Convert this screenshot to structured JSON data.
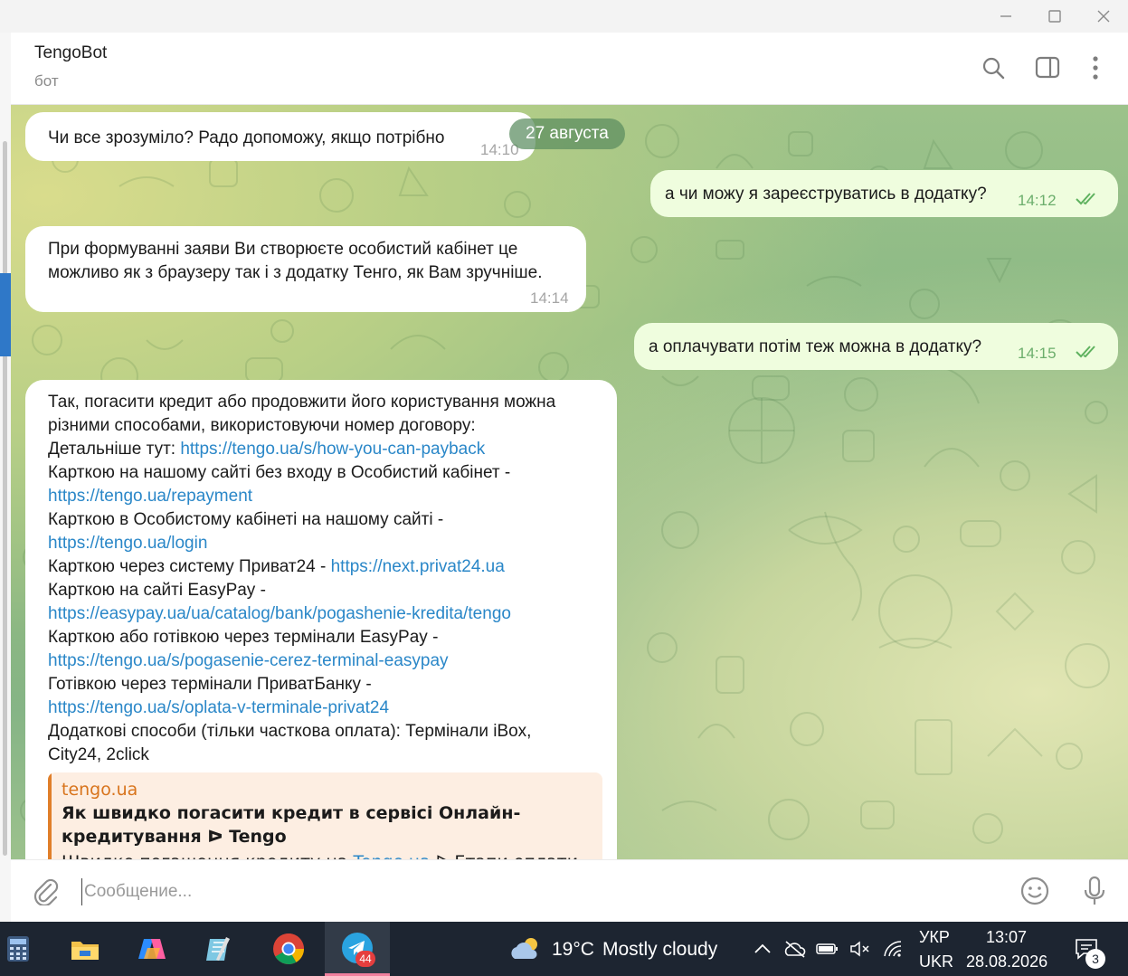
{
  "window": {
    "minimize": "—",
    "maximize": "☐",
    "close": "✕"
  },
  "header": {
    "title": "TengoBot",
    "subtitle": "бот"
  },
  "chat": {
    "date_separator": "27 августа",
    "messages": [
      {
        "id": "m1",
        "direction": "in",
        "text": "Чи все зрозуміло? Радо допоможу, якщо потрібно",
        "time": "14:10"
      },
      {
        "id": "m2",
        "direction": "out",
        "text": "а чи можу я зареєструватись в додатку?",
        "time": "14:12",
        "status": "read"
      },
      {
        "id": "m3",
        "direction": "in",
        "lines": [
          "При формуванні заяви Ви створюєте особистий кабінет це",
          "можливо як з браузеру так і з додатку Тенго, як Вам зручніше."
        ],
        "time": "14:14"
      },
      {
        "id": "m4",
        "direction": "out",
        "text": "а оплачувати потім теж можна в додатку?",
        "time": "14:15",
        "status": "read"
      },
      {
        "id": "m5",
        "direction": "in",
        "lines": [
          {
            "text": "Так, погасити кредит або продовжити його користування можна"
          },
          {
            "text": "різними способами, використовуючи номер договору:"
          },
          {
            "text": "Детальніше тут: ",
            "link": "https://tengo.ua/s/how-you-can-payback"
          },
          {
            "text": "Карткою на нашому сайті без входу в Особистий кабінет -"
          },
          {
            "link": "https://tengo.ua/repayment"
          },
          {
            "text": "Карткою в Особистому кабінеті на нашому сайті -"
          },
          {
            "link": "https://tengo.ua/login"
          },
          {
            "text": "Карткою через систему Приват24 - ",
            "link": "https://next.privat24.ua"
          },
          {
            "text": "Карткою на сайті EasyPay -"
          },
          {
            "link": "https://easypay.ua/ua/catalog/bank/pogashenie-kredita/tengo"
          },
          {
            "text": "Карткою або готівкою через термінали EasyPay -"
          },
          {
            "link": "https://tengo.ua/s/pogasenie-cerez-terminal-easypay"
          },
          {
            "text": "Готівкою через термінали ПриватБанку -"
          },
          {
            "link": "https://tengo.ua/s/oplata-v-terminale-privat24"
          },
          {
            "text": "Додаткові способи (тільки часткова оплата): Термінали iBox,"
          },
          {
            "text": "City24, 2click"
          }
        ],
        "preview": {
          "site": "tengo.ua",
          "title": "Як швидко погасити кредит в сервісі Онлайн-кредитування ᐅ Tengo",
          "desc_prefix": "Швидке погашення кредиту на ",
          "desc_link": "Tengo.ua",
          "desc_suffix": " ᐅ Етапи оплати"
        }
      }
    ]
  },
  "composer": {
    "placeholder": "Сообщение..."
  },
  "taskbar": {
    "weather": {
      "temp": "19°C",
      "condition": "Mostly cloudy"
    },
    "telegram_badge": "44",
    "lang_top": "УКР",
    "lang_bottom": "UKR",
    "time": "13:07",
    "date": "28.08.2026",
    "notifications": "3"
  },
  "colors": {
    "incoming": "#ffffff",
    "outgoing": "#effdde",
    "link": "#2a87c8",
    "read_ticks": "#5fb25f",
    "preview_accent": "#e07f2a",
    "taskbar": "#1d2531"
  }
}
